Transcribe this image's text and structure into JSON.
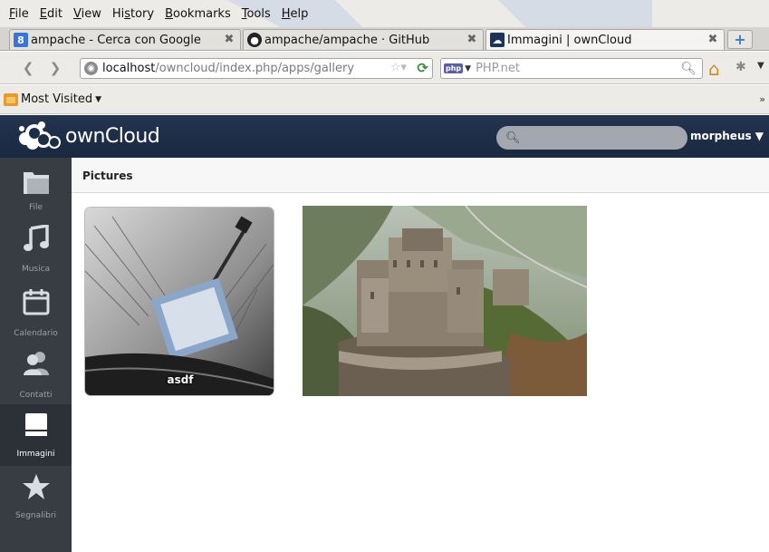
{
  "browser": {
    "menu": [
      {
        "key": "F",
        "rest": "ile"
      },
      {
        "key": "E",
        "rest": "dit"
      },
      {
        "key": "V",
        "rest": "iew"
      },
      {
        "pre": "Hi",
        "key": "s",
        "rest": "tory"
      },
      {
        "key": "B",
        "rest": "ookmarks"
      },
      {
        "key": "T",
        "rest": "ools"
      },
      {
        "key": "H",
        "rest": "elp"
      }
    ],
    "tabs": [
      {
        "label": "ampache - Cerca con Google",
        "icon": "google-icon"
      },
      {
        "label": "ampache/ampache · GitHub",
        "icon": "github-icon"
      },
      {
        "label": "Immagini | ownCloud",
        "icon": "owncloud-icon"
      }
    ],
    "url_host": "localhost",
    "url_path": "/owncloud/index.php/apps/gallery",
    "search_engine": "php",
    "search_placeholder": "PHP.net",
    "bookmarks_label": "Most Visited",
    "overflow": "»"
  },
  "owncloud": {
    "logo_text": "ownCloud",
    "username": "morpheus ▼",
    "search_icon": "search-icon",
    "sidebar": [
      {
        "label": "File",
        "icon": "folder-icon"
      },
      {
        "label": "Musica",
        "icon": "music-note-icon"
      },
      {
        "label": "Calendario",
        "icon": "calendar-icon"
      },
      {
        "label": "Contatti",
        "icon": "contacts-icon"
      },
      {
        "label": "Immagini",
        "icon": "image-icon",
        "active": true
      },
      {
        "label": "Segnalibri",
        "icon": "star-icon"
      }
    ],
    "breadcrumb": "Pictures",
    "gallery": [
      {
        "type": "album",
        "label": "asdf"
      },
      {
        "type": "photo",
        "label": ""
      }
    ]
  }
}
